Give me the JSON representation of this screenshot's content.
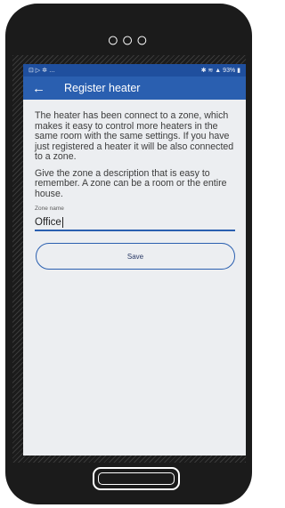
{
  "status_bar": {
    "left_icons": [
      "mail-icon",
      "play-icon",
      "fan-icon",
      "more-icon"
    ],
    "left_text": "⊡ ▷ ✲ …",
    "right_text": "✱ ≋ ▲ 93% ▮"
  },
  "app_bar": {
    "back_glyph": "←",
    "title": "Register heater"
  },
  "content": {
    "paragraph_1": "The heater has been connect to a zone, which makes it easy to control more heaters in the same room with the same settings. If you have just registered a heater it will be also connected to a zone.",
    "paragraph_2": "Give the zone a description that is easy to remember. A zone can be a room or the entire house.",
    "zone_label": "Zone name",
    "zone_value": "Office",
    "save_label": "Save"
  },
  "device": {
    "top_dots": "○○○"
  }
}
